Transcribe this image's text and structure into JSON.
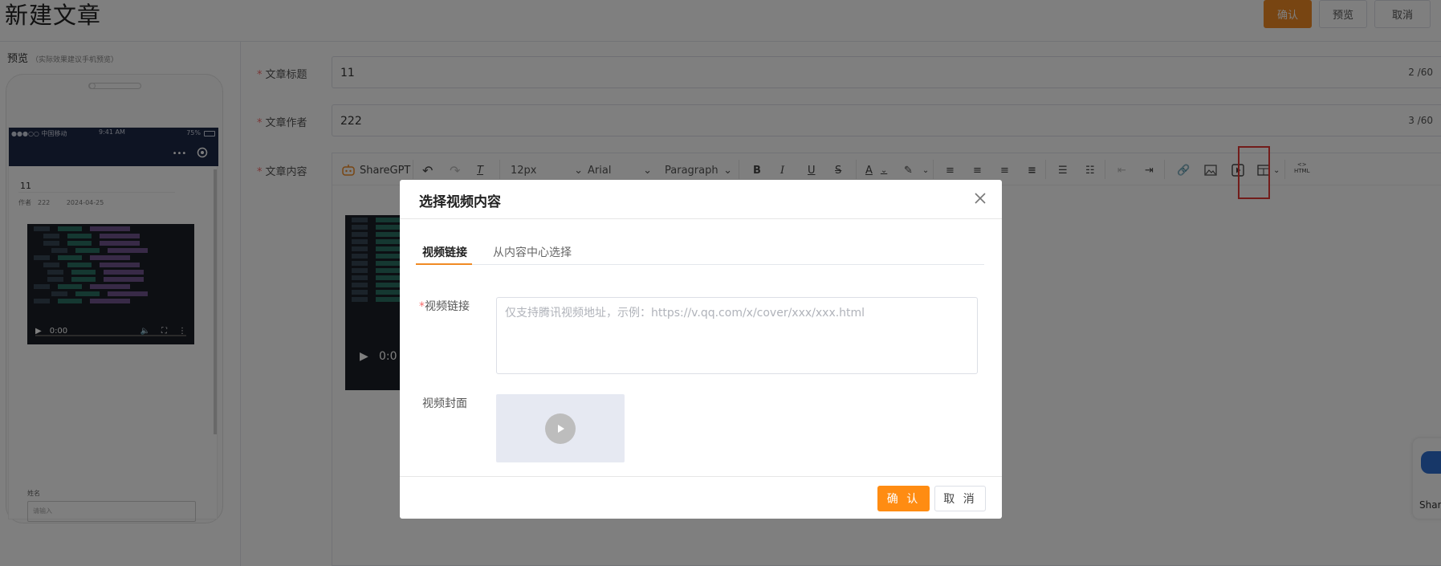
{
  "page": {
    "title": "新建文章",
    "buttons": {
      "confirm": "确认",
      "preview": "预览",
      "cancel": "取消"
    }
  },
  "preview": {
    "label": "预览",
    "hint": "（实际效果建议手机预览）",
    "status": {
      "carrier": "●●●○○ 中国移动",
      "time": "9:41 AM",
      "battery": "75%"
    },
    "capsule": {
      "menu": "•••"
    },
    "article_title": "11",
    "author_label": "作者",
    "author": "222",
    "date": "2024-04-25",
    "video_time": "0:00",
    "name_label": "姓名",
    "name_placeholder": "请输入"
  },
  "form": {
    "title_label": "文章标题",
    "title_value": "11",
    "title_count": "2 /60",
    "author_label": "文章作者",
    "author_value": "222",
    "author_count": "3 /60",
    "content_label": "文章内容"
  },
  "toolbar": {
    "sharegpt": "ShareGPT",
    "font_size": "12px",
    "font_family": "Arial",
    "block_format": "Paragraph",
    "html": "HTML"
  },
  "editor": {
    "video_time": "0:0"
  },
  "assistant": {
    "label": "Share"
  },
  "dialog": {
    "title": "选择视频内容",
    "tabs": [
      "视频链接",
      "从内容中心选择"
    ],
    "link_label": "视频链接",
    "link_required_mark": "*",
    "link_placeholder": "仅支持腾讯视频地址，示例：https://v.qq.com/x/cover/xxx/xxx.html",
    "cover_label": "视频封面",
    "confirm": "确 认",
    "cancel": "取 消"
  },
  "colors": {
    "accent": "#f08a24",
    "highlight": "#e53935"
  }
}
